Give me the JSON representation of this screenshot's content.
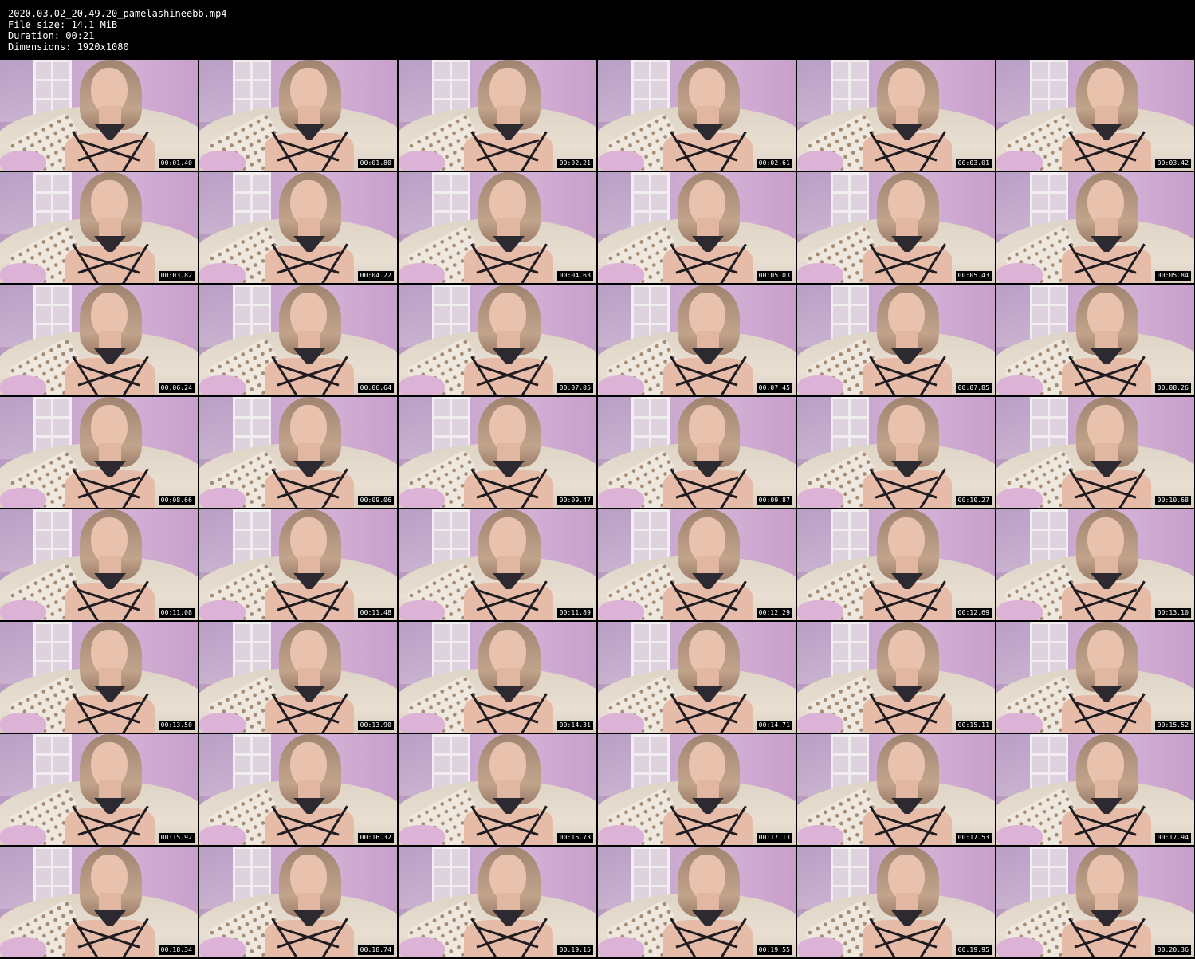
{
  "header": {
    "filename_line": "2020.03.02_20.49.20_pamelashineebb.mp4",
    "filesize_line": "File size: 14.1 MiB",
    "duration_line": "Duration: 00:21",
    "dimensions_line": "Dimensions: 1920x1080"
  },
  "thumbnails": [
    {
      "timestamp": "00:01.40"
    },
    {
      "timestamp": "00:01.80"
    },
    {
      "timestamp": "00:02.21"
    },
    {
      "timestamp": "00:02.61"
    },
    {
      "timestamp": "00:03.01"
    },
    {
      "timestamp": "00:03.42"
    },
    {
      "timestamp": "00:03.82"
    },
    {
      "timestamp": "00:04.22"
    },
    {
      "timestamp": "00:04.63"
    },
    {
      "timestamp": "00:05.03"
    },
    {
      "timestamp": "00:05.43"
    },
    {
      "timestamp": "00:05.84"
    },
    {
      "timestamp": "00:06.24"
    },
    {
      "timestamp": "00:06.64"
    },
    {
      "timestamp": "00:07.05"
    },
    {
      "timestamp": "00:07.45"
    },
    {
      "timestamp": "00:07.85"
    },
    {
      "timestamp": "00:08.26"
    },
    {
      "timestamp": "00:08.66"
    },
    {
      "timestamp": "00:09.06"
    },
    {
      "timestamp": "00:09.47"
    },
    {
      "timestamp": "00:09.87"
    },
    {
      "timestamp": "00:10.27"
    },
    {
      "timestamp": "00:10.68"
    },
    {
      "timestamp": "00:11.08"
    },
    {
      "timestamp": "00:11.48"
    },
    {
      "timestamp": "00:11.89"
    },
    {
      "timestamp": "00:12.29"
    },
    {
      "timestamp": "00:12.69"
    },
    {
      "timestamp": "00:13.10"
    },
    {
      "timestamp": "00:13.50"
    },
    {
      "timestamp": "00:13.90"
    },
    {
      "timestamp": "00:14.31"
    },
    {
      "timestamp": "00:14.71"
    },
    {
      "timestamp": "00:15.11"
    },
    {
      "timestamp": "00:15.52"
    },
    {
      "timestamp": "00:15.92"
    },
    {
      "timestamp": "00:16.32"
    },
    {
      "timestamp": "00:16.73"
    },
    {
      "timestamp": "00:17.13"
    },
    {
      "timestamp": "00:17.53"
    },
    {
      "timestamp": "00:17.94"
    },
    {
      "timestamp": "00:18.34"
    },
    {
      "timestamp": "00:18.74"
    },
    {
      "timestamp": "00:19.15"
    },
    {
      "timestamp": "00:19.55"
    },
    {
      "timestamp": "00:19.95"
    },
    {
      "timestamp": "00:20.36"
    }
  ]
}
